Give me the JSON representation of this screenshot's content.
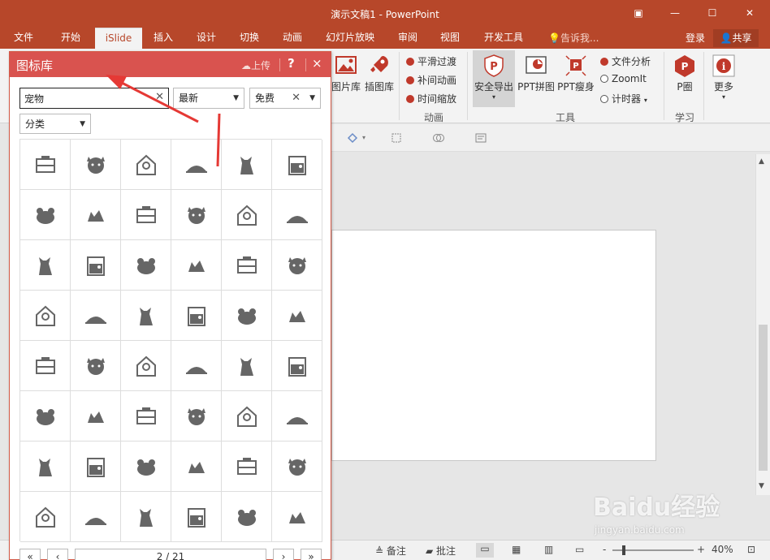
{
  "window": {
    "title": "演示文稿1 - PowerPoint",
    "controls": [
      "restore-icon",
      "minimize-icon",
      "maximize-icon",
      "close-icon"
    ]
  },
  "menu": {
    "tabs": [
      {
        "label": "文件"
      },
      {
        "label": "开始"
      },
      {
        "label": "iSlide",
        "active": true
      },
      {
        "label": "插入"
      },
      {
        "label": "设计"
      },
      {
        "label": "切换"
      },
      {
        "label": "动画"
      },
      {
        "label": "幻灯片放映"
      },
      {
        "label": "审阅"
      },
      {
        "label": "视图"
      },
      {
        "label": "开发工具"
      }
    ],
    "tell_me": "告诉我...",
    "login": "登录",
    "share": "共享"
  },
  "ribbon": {
    "picture_lib": "图片库",
    "illustration_lib": "插图库",
    "smooth_transition": "平滑过渡",
    "tween_animation": "补间动画",
    "time_scale": "时间缩放",
    "group_animation": "动画",
    "safe_export": "安全导出",
    "ppt_collage": "PPT拼图",
    "ppt_slim": "PPT瘦身",
    "file_analysis": "文件分析",
    "zoomit": "ZoomIt",
    "timer": "计时器",
    "group_tools": "工具",
    "p_circle": "P圈",
    "group_learn": "学习",
    "more": "更多",
    "accent": "#c0392b"
  },
  "panel": {
    "title": "图标库",
    "upload": "上传",
    "help": "?",
    "close": "×",
    "search_value": "宠物",
    "sort_value": "最新",
    "price_value": "免费",
    "category_value": "分类",
    "icons": [
      "pet-carrier-icon",
      "pet-carrier-icon",
      "cat-face-icon",
      "dog-head-icon",
      "bird-house-icon",
      "pet-bed-icon",
      "pet-bed-icon",
      "sitting-dog-icon",
      "two-dogs-icon",
      "hamster-cage-icon",
      "sitting-cat-icon",
      "aquarium-icon",
      "hedgehog-icon",
      "aquarium-icon",
      "rabbit-icon",
      "grooming-glove-icon",
      "pet-cage-icon",
      "dog-bone-icon",
      "pig-face-icon",
      "rabbit-icon",
      "dog-icon",
      "spaniel-face-icon",
      "mouse-icon",
      "hamster-icon",
      "seal-icon",
      "sitting-dog-icon",
      "bear-face-icon",
      "fish-icon",
      "rat-icon",
      "fish-bowl-icon",
      "cat-icon",
      "dog-portrait-icon",
      "bird-cage-icon",
      "pet-bed-icon",
      "stethoscope-icon",
      "dog-walker-icon",
      "dogs-icon",
      "dog-outline-icon",
      "pet-collar-icon",
      "pet-bowl-icon",
      "pet-owner-icon",
      "person-dog-icon",
      "dog-face-icon",
      "dog-walker-icon",
      "bear-face-icon",
      "pet-food-icon",
      "bird-house-icon",
      "paw-print-icon"
    ],
    "page": "2 / 21",
    "pager": {
      "first": "«",
      "prev": "‹",
      "next": "›",
      "last": "»"
    }
  },
  "status": {
    "notes": "备注",
    "comments": "批注",
    "zoom": "40%",
    "zoom_minus": "-",
    "zoom_plus": "+"
  },
  "watermark": {
    "brand": "Baidu经验",
    "url": "jingyan.baidu.com"
  }
}
